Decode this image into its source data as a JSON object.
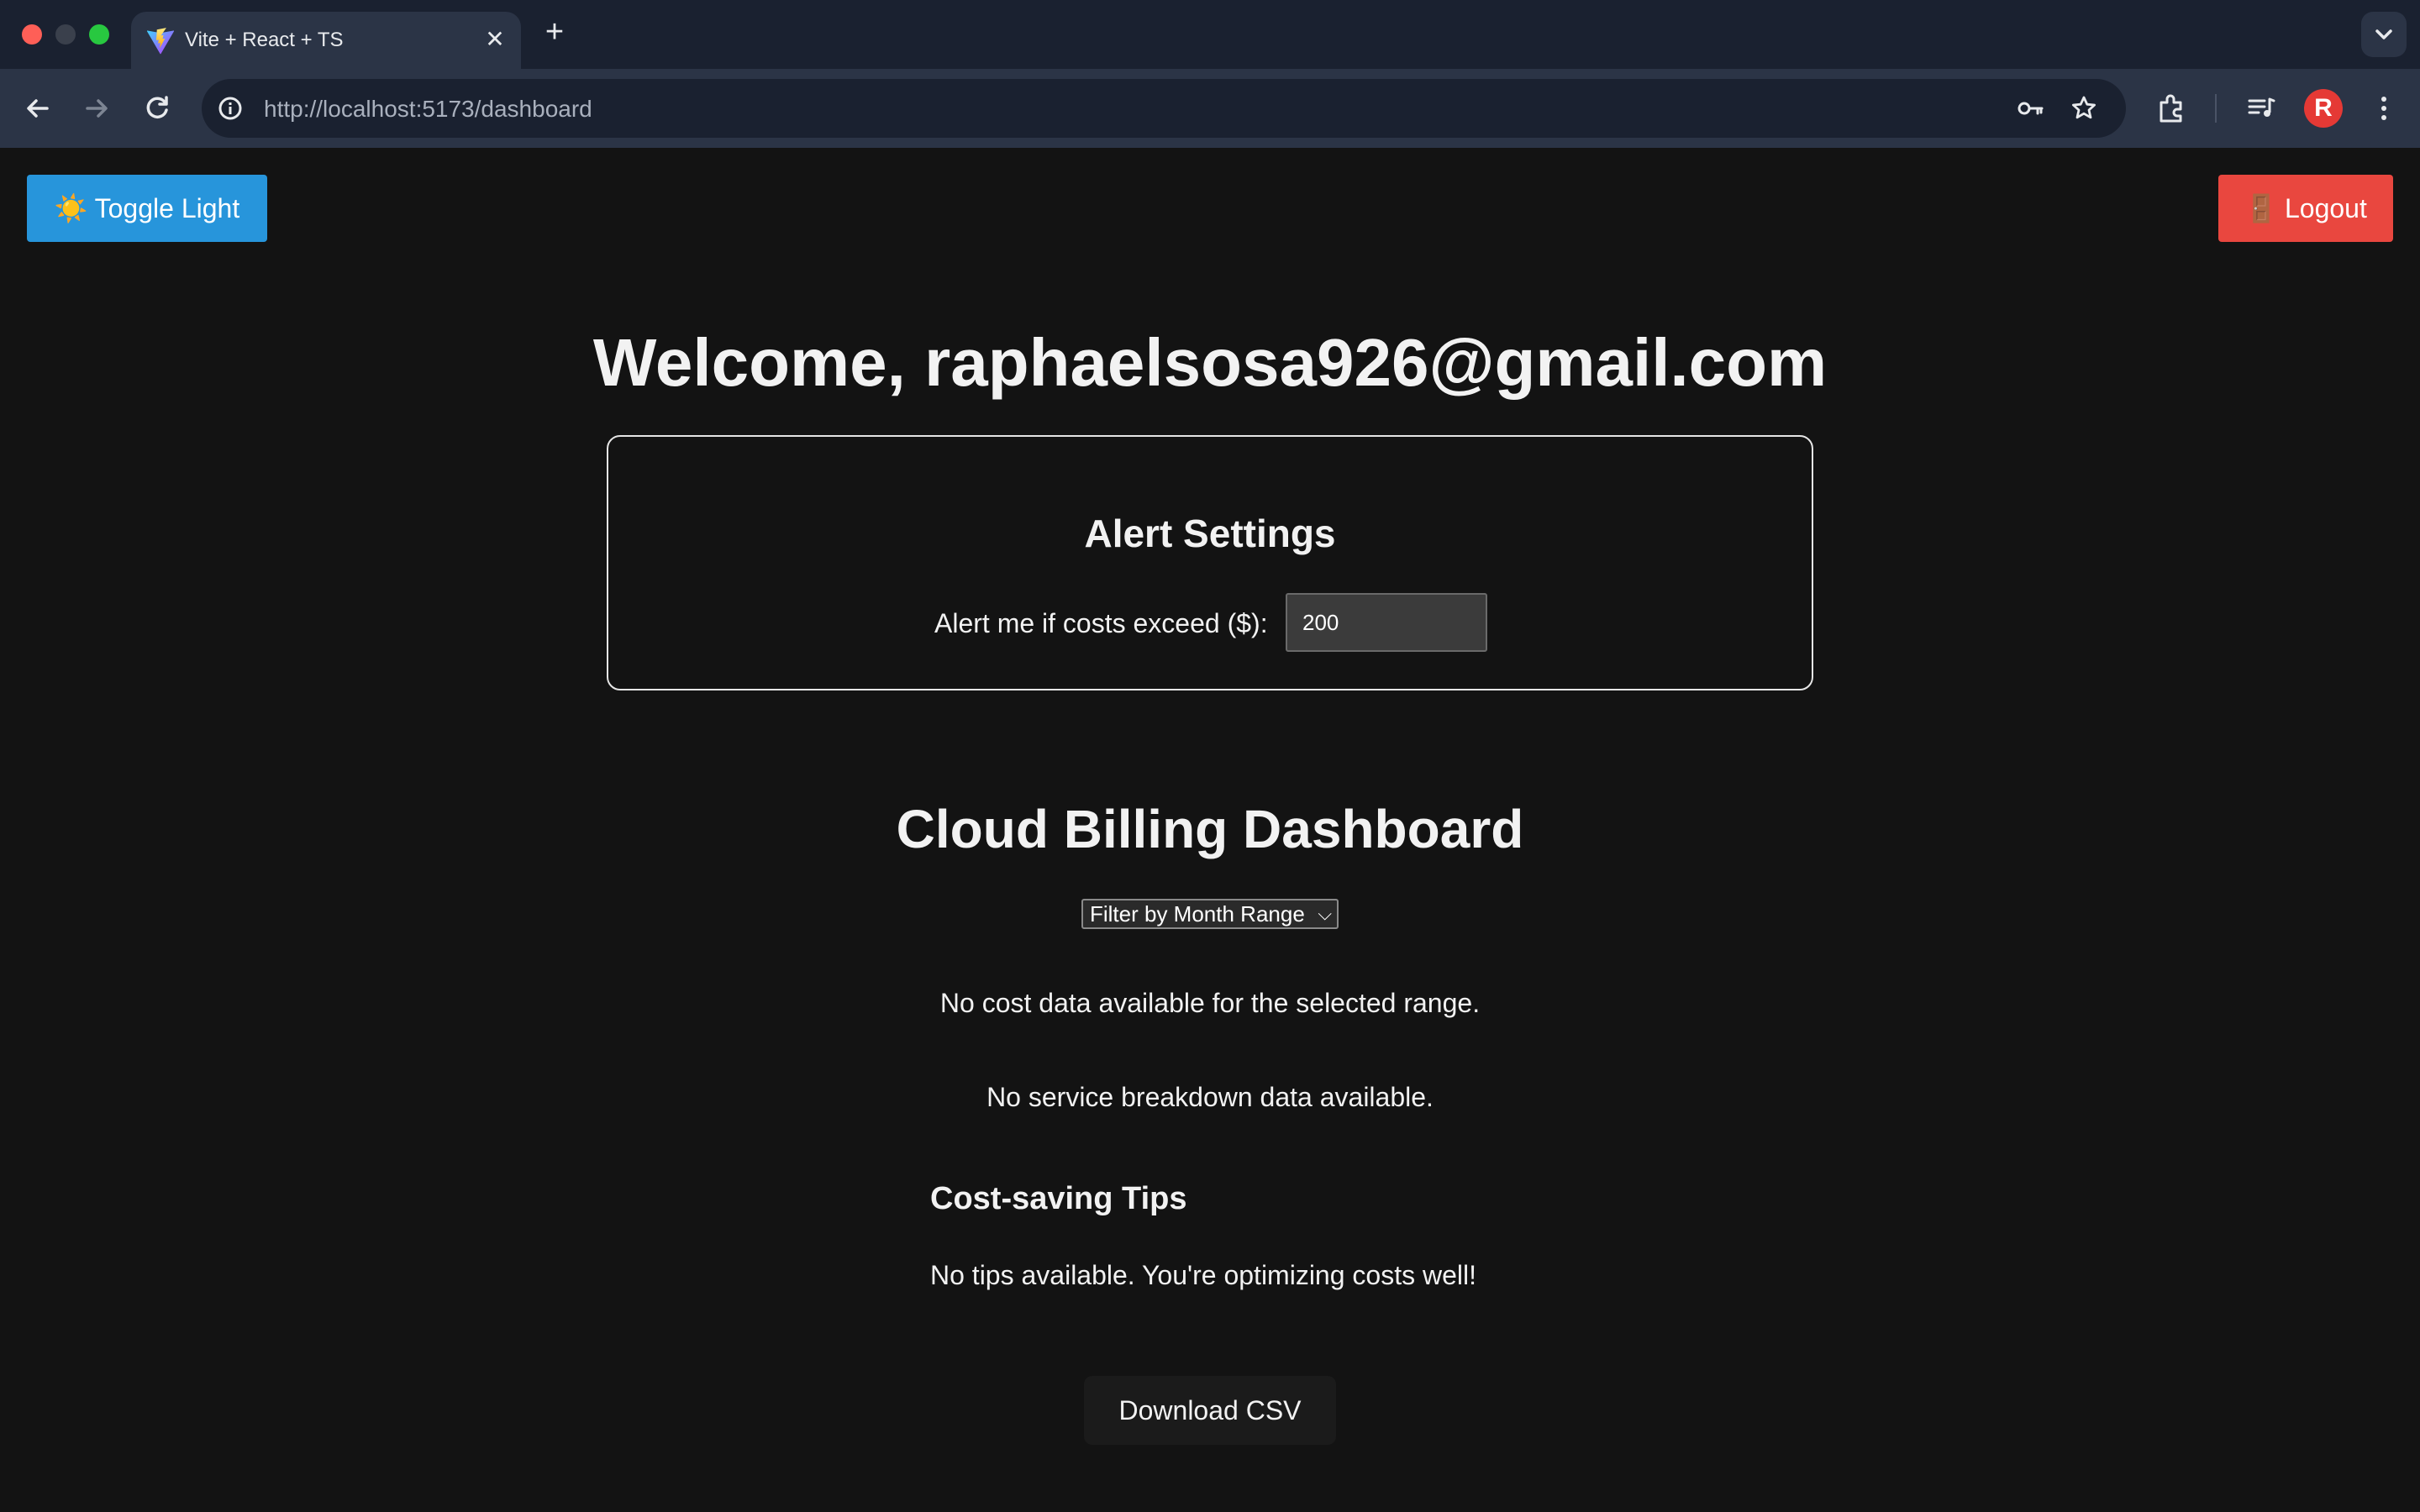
{
  "browser": {
    "tab_title": "Vite + React + TS",
    "url_host": "http://localhost",
    "url_rest": ":5173/dashboard"
  },
  "page": {
    "toggle_label": "Toggle Light",
    "toggle_emoji": "☀️",
    "logout_label": "Logout",
    "logout_emoji": "🚪",
    "welcome": "Welcome, raphaelsosa926@gmail.com",
    "alert": {
      "title": "Alert Settings",
      "label": "Alert me if costs exceed ($):",
      "value": "200"
    },
    "dashboard_title": "Cloud Billing Dashboard",
    "filter_selected": "Filter by Month Range",
    "no_cost": "No cost data available for the selected range.",
    "no_service": "No service breakdown data available.",
    "tips_heading": "Cost-saving Tips",
    "tips_msg": "No tips available. You're optimizing costs well!",
    "download_label": "Download CSV"
  },
  "colors": {
    "toggle_bg": "#2795db",
    "logout_bg": "#e9473f",
    "page_bg": "#131313"
  },
  "icons": {
    "toggle": "sun-icon",
    "logout": "door-icon"
  }
}
